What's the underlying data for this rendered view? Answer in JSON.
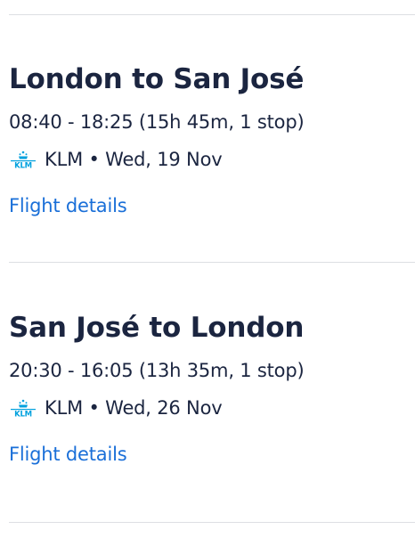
{
  "legs": [
    {
      "route": "London to San José",
      "times": "08:40 - 18:25 (15h 45m, 1 stop)",
      "airline_logo": "klm-logo-icon",
      "airline_date": "KLM • Wed, 19 Nov",
      "details_link": "Flight details"
    },
    {
      "route": "San José to London",
      "times": "20:30 - 16:05 (13h 35m, 1 stop)",
      "airline_logo": "klm-logo-icon",
      "airline_date": "KLM • Wed, 26 Nov",
      "details_link": "Flight details"
    }
  ],
  "colors": {
    "text": "#1b2540",
    "link": "#1a6fd8",
    "divider": "#dddfe3",
    "klm_blue": "#00a1de"
  }
}
